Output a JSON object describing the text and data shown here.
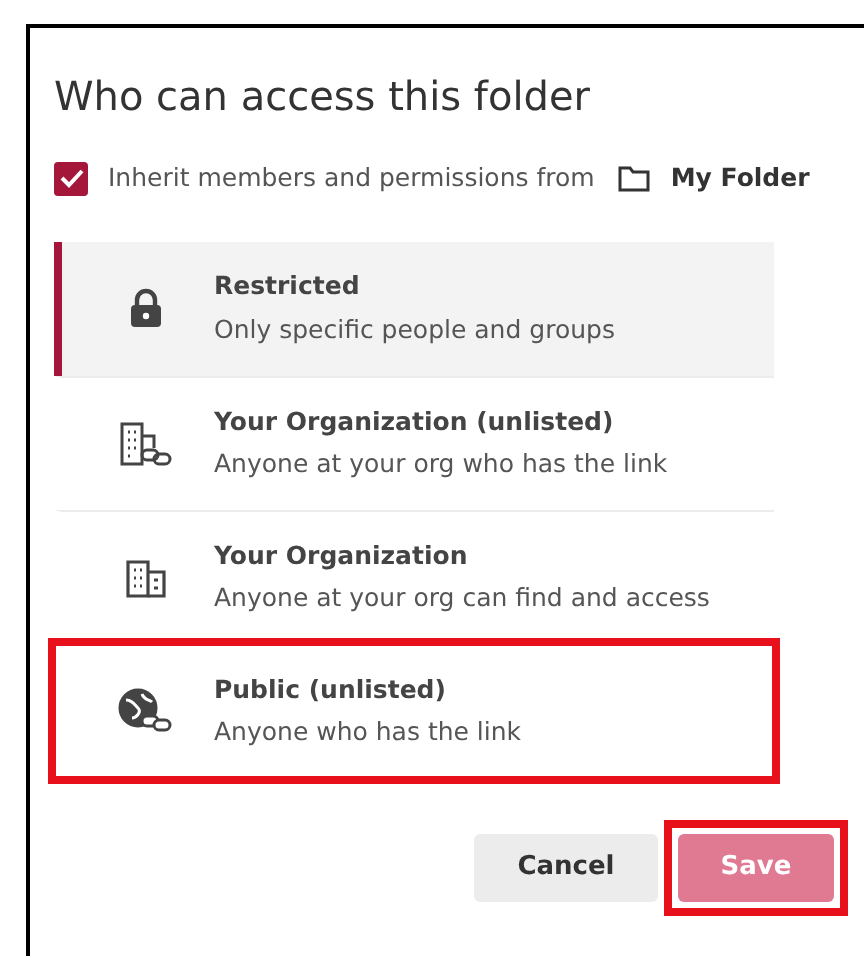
{
  "dialog": {
    "title": "Who can access this folder"
  },
  "inherit": {
    "checked": true,
    "label": "Inherit members and permissions from",
    "folder": "My Folder"
  },
  "options": [
    {
      "kind": "lock",
      "title": "Restricted",
      "description": "Only specific people and groups",
      "selected": true,
      "highlighted": false
    },
    {
      "kind": "org-link",
      "title": "Your Organization (unlisted)",
      "description": "Anyone at your org who has the link",
      "selected": false,
      "highlighted": false
    },
    {
      "kind": "org",
      "title": "Your Organization",
      "description": "Anyone at your org can find and access",
      "selected": false,
      "highlighted": false
    },
    {
      "kind": "globe-link",
      "title": "Public (unlisted)",
      "description": "Anyone who has the link",
      "selected": false,
      "highlighted": true
    }
  ],
  "buttons": [
    {
      "kind": "secondary",
      "label": "Cancel",
      "disabled": false,
      "highlighted": false
    },
    {
      "kind": "primary",
      "label": "Save",
      "disabled": true,
      "highlighted": true
    }
  ]
}
